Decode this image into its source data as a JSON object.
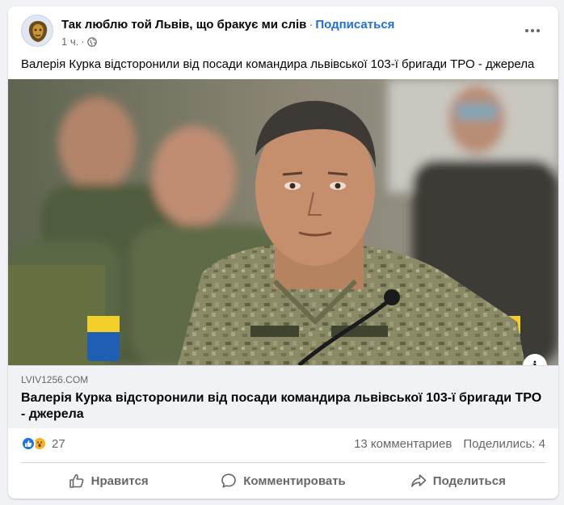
{
  "post": {
    "page_name": "Так люблю той Львів, що бракує ми слів",
    "separator": "·",
    "follow_label": "Подписаться",
    "time": "1 ч.",
    "audience_icon": "globe-icon",
    "more_icon": "more-dots-icon",
    "text": "Валерія Курка відсторонили від посади командира львівської 103-ї бригади ТРО - джерела"
  },
  "link_preview": {
    "domain": "LVIV1256.COM",
    "title": "Валерія Курка відсторонили від посади командира львівської 103-ї бригади ТРО - джерела",
    "info_label": "i"
  },
  "stats": {
    "reaction_icons": [
      "like-reaction-icon",
      "wow-reaction-icon"
    ],
    "reactions_count": "27",
    "comments": "13 комментариев",
    "shares": "Поделились: 4"
  },
  "actions": {
    "like": "Нравится",
    "comment": "Комментировать",
    "share": "Поделиться"
  },
  "colors": {
    "accent": "#216fdb",
    "like": "#1b74e4",
    "wow": "#f7b125",
    "secondary_text": "#65676b"
  }
}
